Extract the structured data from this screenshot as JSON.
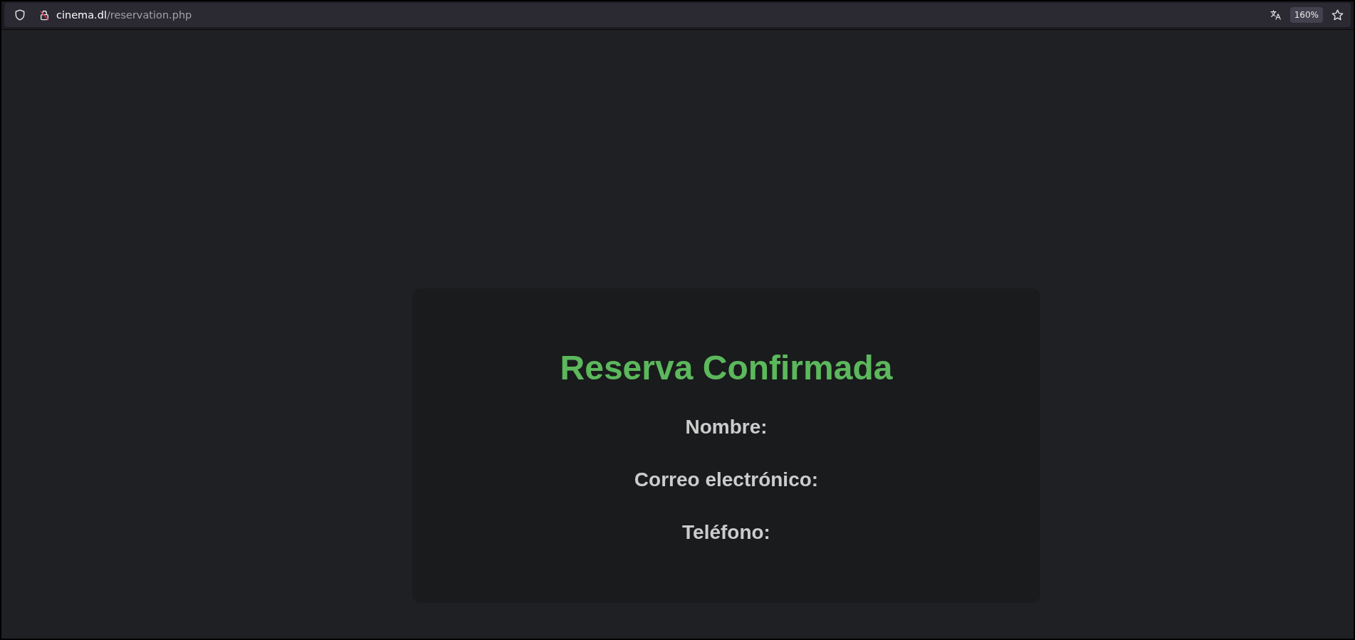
{
  "browser": {
    "url_host": "cinema.dl",
    "url_path": "/reservation.php",
    "zoom": "160%"
  },
  "card": {
    "title": "Reserva Confirmada",
    "fields": [
      {
        "label": "Nombre:"
      },
      {
        "label": "Correo electrónico:"
      },
      {
        "label": "Teléfono:"
      }
    ]
  }
}
